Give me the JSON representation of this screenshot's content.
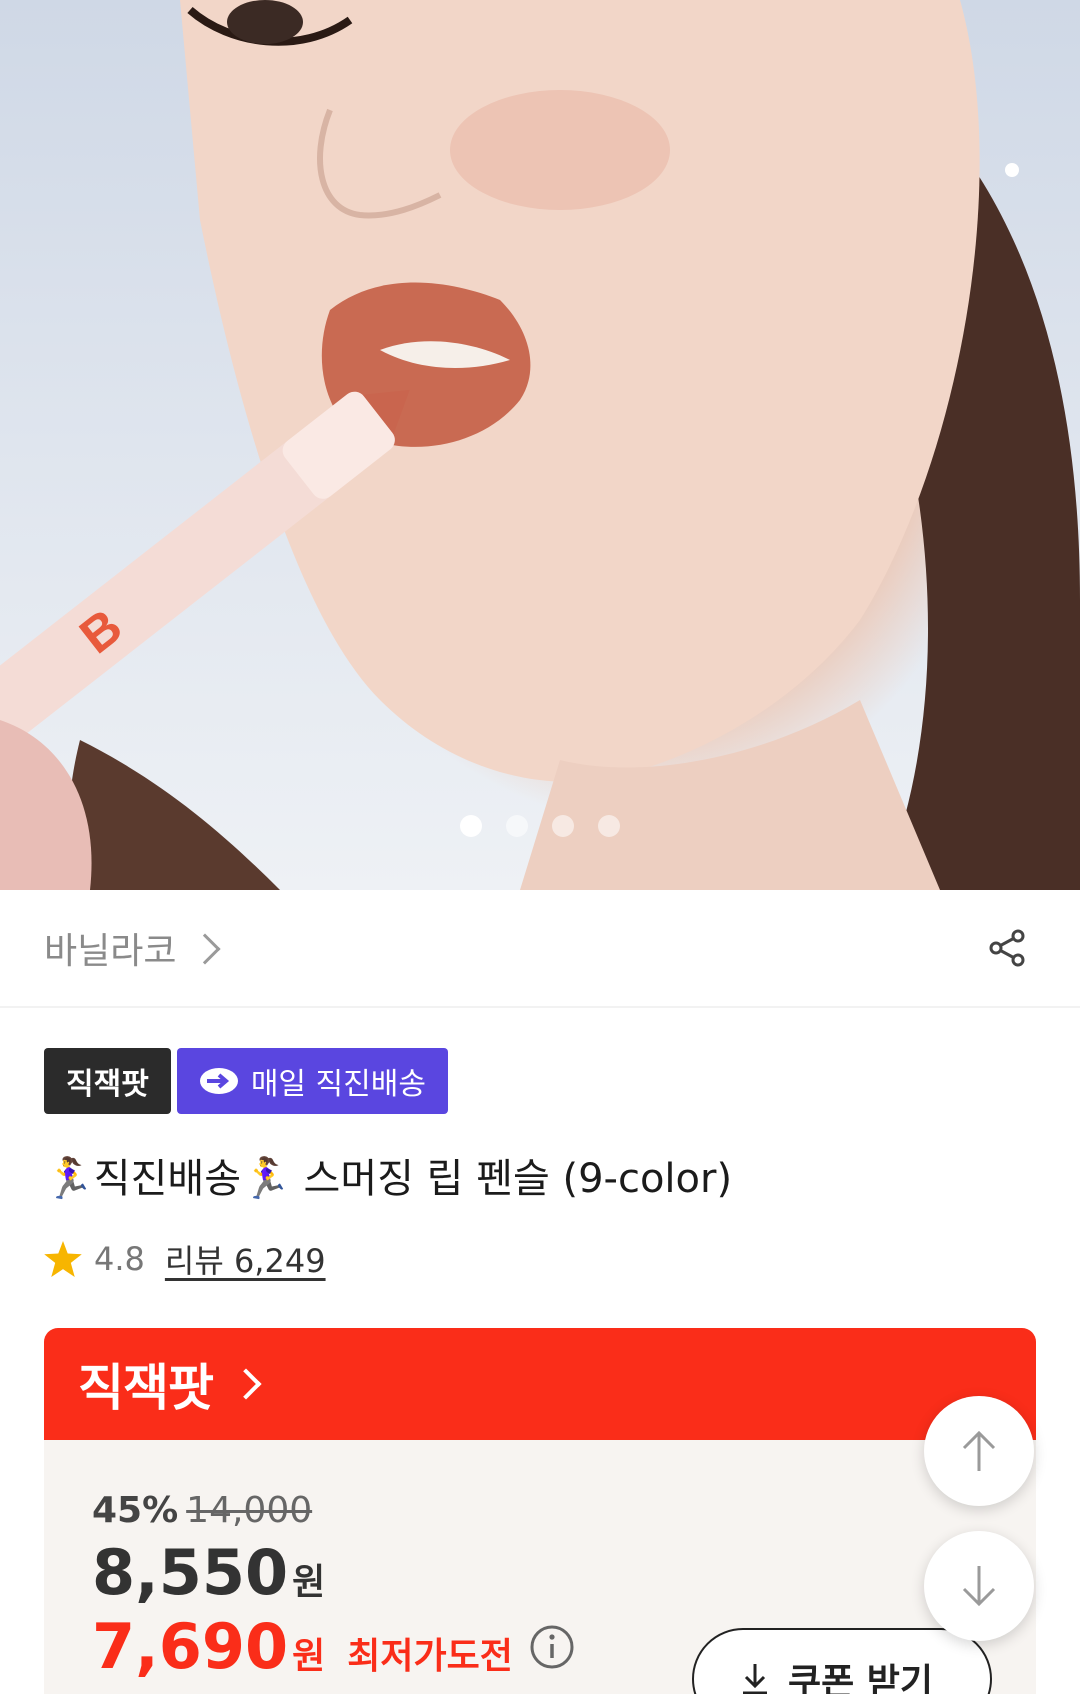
{
  "hero": {
    "slide_count": 4,
    "active_slide": 1
  },
  "brand": {
    "name": "바닐라코"
  },
  "badges": {
    "deal": "직잭팟",
    "delivery": "매일 직진배송"
  },
  "product": {
    "title": "🏃‍♀️직진배송🏃‍♀️ 스머징 립 펜슬 (9-color)",
    "rating": "4.8",
    "review_link": "리뷰 6,249"
  },
  "deal": {
    "header": "직잭팟",
    "discount": "45%",
    "original_price": "14,000",
    "sale_price": "8,550",
    "currency": "원",
    "best_price": "7,690",
    "best_label": "최저가도전",
    "coupon_button": "쿠폰 받기"
  },
  "colors": {
    "accent_red": "#fa2d19",
    "badge_purple": "#5a46e0",
    "badge_dark": "#2b2b2b",
    "star": "#f7b500"
  },
  "icons": {
    "brand_chevron": "chevron-right-icon",
    "share": "share-icon",
    "delivery": "delivery-arrow-icon",
    "star": "star-icon",
    "info": "info-icon",
    "coupon": "download-icon",
    "scroll_up": "arrow-up-icon",
    "scroll_down": "arrow-down-icon"
  }
}
